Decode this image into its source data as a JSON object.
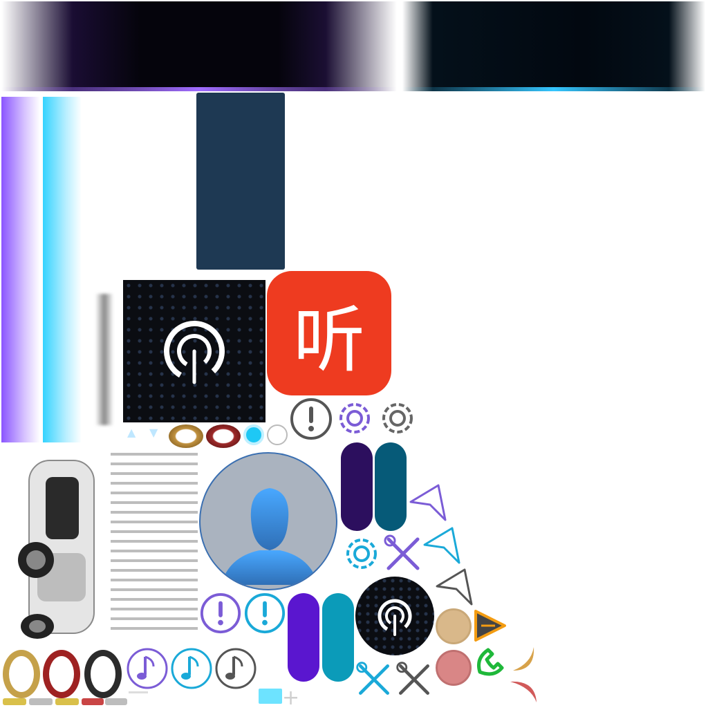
{
  "sprites": {
    "app_icon_text": "听",
    "colors": {
      "purple": "#7b5cd6",
      "cyan": "#1aa9d8",
      "gray": "#666666",
      "navy": "#1e3953",
      "red_app": "#ee3b20",
      "dark_purple_pill": "#2c0f5e",
      "teal_pill": "#065a78",
      "violet_pill": "#5a16cf",
      "cyan_pill": "#0b9bb9"
    },
    "icons": [
      "header-bar-purple-glow",
      "header-bar-cyan-glow",
      "vertical-glow-purple",
      "vertical-glow-cyan",
      "podcast-app-icon",
      "ting-app-icon",
      "exclamation-circle-icon",
      "settings-gear-icon",
      "user-avatar-icon",
      "send-arrow-icon",
      "tools-wrench-icon",
      "music-note-icon",
      "tire-icon",
      "phone-icon",
      "warning-triangle-icon",
      "car-image"
    ]
  }
}
